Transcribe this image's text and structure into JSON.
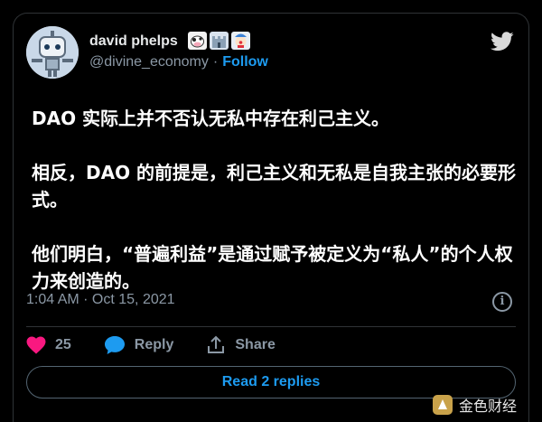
{
  "tweet": {
    "author_name": "david phelps",
    "author_emojis": [
      "cow-emoji",
      "castle-emoji",
      "clown-emoji"
    ],
    "handle": "@divine_economy",
    "separator": "·",
    "follow_label": "Follow",
    "body": [
      "DAO 实际上并不否认无私中存在利己主义。",
      "相反，DAO 的前提是，利己主义和无私是自我主张的必要形式。",
      "他们明白，“普遍利益”是通过赋予被定义为“私人”的个人权力来创造的。"
    ],
    "timestamp": "1:04 AM · Oct 15, 2021",
    "like_count": "25",
    "reply_label": "Reply",
    "share_label": "Share",
    "read_replies_label": "Read 2 replies"
  },
  "watermark": {
    "text": "金色财经"
  },
  "colors": {
    "accent": "#1d9bf0",
    "like": "#f91880",
    "muted": "#8b98a5",
    "background": "#000000"
  },
  "icons": [
    "twitter-bird-icon",
    "info-icon",
    "heart-icon",
    "reply-bubble-icon",
    "share-icon",
    "watermark-logo-icon"
  ]
}
